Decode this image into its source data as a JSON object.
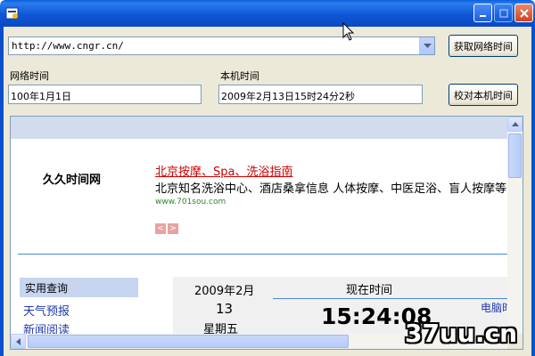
{
  "toolbar": {
    "url_value": "http://www.cngr.cn/",
    "fetch_button_label": "获取网络时间",
    "sync_button_label": "校对本机时间"
  },
  "fields": {
    "network_time_label": "网络时间",
    "network_time_value": "100年1月1日",
    "local_time_label": "本机时间",
    "local_time_value": "2009年2月13日15时24分2秒"
  },
  "webpage": {
    "site_name": "久久时间网",
    "ad": {
      "title": "北京按摩、Spa、洗浴指南",
      "description": "北京知名洗浴中心、酒店桑拿信息 人体按摩、中医足浴、盲人按摩等",
      "url": "www.701sou.com"
    },
    "query_section": {
      "header": "实用查询",
      "links": [
        "天气预报",
        "新闻阅读"
      ]
    },
    "calendar": {
      "month": "2009年2月",
      "day": "13",
      "weekday": "星期五"
    },
    "clock": {
      "label": "现在时间",
      "time": "15:24:08",
      "pc_link": "电脑时"
    }
  },
  "watermark": "37uu.cn",
  "colors": {
    "title_bar": "#0a5fd8",
    "ad_title": "#cc0000",
    "link": "#1f3aa8",
    "ad_url": "#2a8a2a"
  }
}
